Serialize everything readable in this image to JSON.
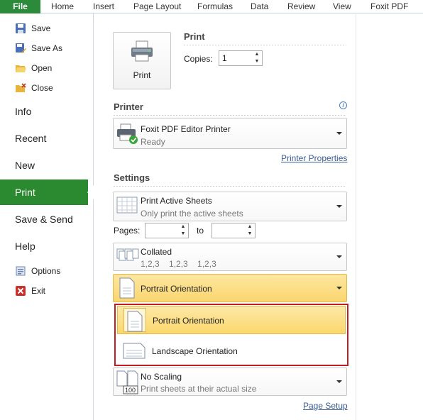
{
  "ribbon": {
    "tabs": [
      "File",
      "Home",
      "Insert",
      "Page Layout",
      "Formulas",
      "Data",
      "Review",
      "View",
      "Foxit PDF"
    ]
  },
  "nav": {
    "save": "Save",
    "save_as": "Save As",
    "open": "Open",
    "close": "Close",
    "info": "Info",
    "recent": "Recent",
    "new": "New",
    "print": "Print",
    "save_send": "Save & Send",
    "help": "Help",
    "options": "Options",
    "exit": "Exit"
  },
  "print": {
    "title": "Print",
    "button_label": "Print",
    "copies_label": "Copies:",
    "copies_value": "1"
  },
  "printer": {
    "title": "Printer",
    "name": "Foxit PDF Editor Printer",
    "status": "Ready",
    "properties_link": "Printer Properties"
  },
  "settings": {
    "title": "Settings",
    "scope_main": "Print Active Sheets",
    "scope_sub": "Only print the active sheets",
    "pages_label": "Pages:",
    "pages_to": "to",
    "collate_main": "Collated",
    "collate_sub": "1,2,3    1,2,3    1,2,3",
    "orientation_value": "Portrait Orientation",
    "scaling_main": "No Scaling",
    "scaling_sub": "Print sheets at their actual size",
    "page_setup_link": "Page Setup"
  },
  "orientation_menu": {
    "options": [
      "Portrait Orientation",
      "Landscape Orientation"
    ],
    "selected": "Portrait Orientation"
  },
  "colors": {
    "file_tab": "#2c8a3b",
    "active_nav": "#2b8a2f",
    "selection": "#fbd76c",
    "highlight_border": "#c21d22"
  }
}
